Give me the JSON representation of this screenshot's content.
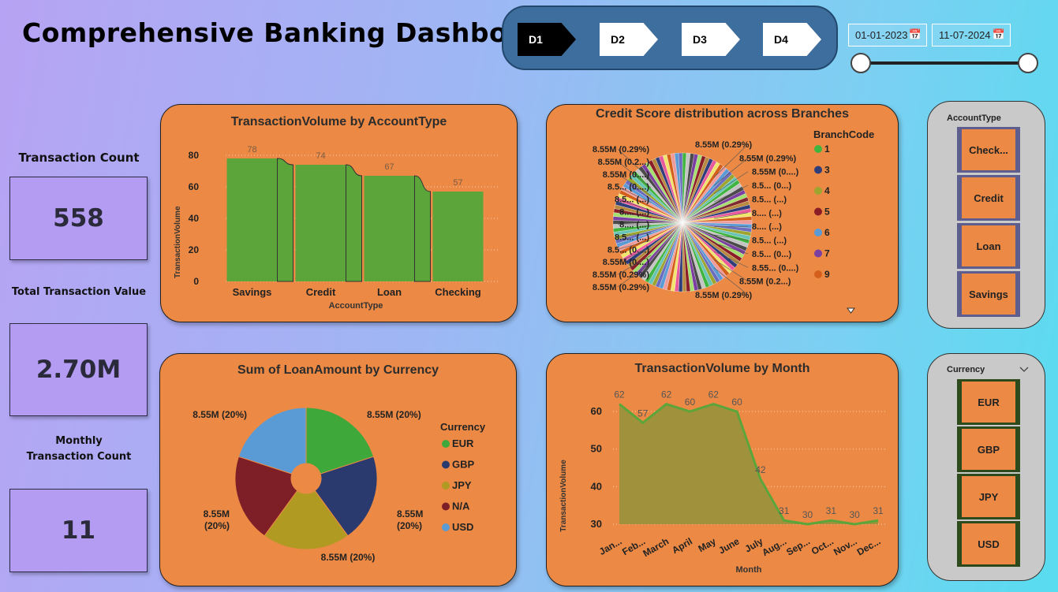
{
  "title": "Comprehensive Banking Dashboard",
  "nav": {
    "buttons": [
      "D1",
      "D2",
      "D3",
      "D4"
    ],
    "active": "D1"
  },
  "date_range": {
    "start": "01-01-2023",
    "end": "11-07-2024"
  },
  "kpis": [
    {
      "label": "Transaction Count",
      "value": "558"
    },
    {
      "label": "Total Transaction Value",
      "value": "2.70M"
    },
    {
      "label": "Monthly Transaction Count",
      "value": "11"
    }
  ],
  "charts": {
    "tv_by_account": {
      "title": "TransactionVolume by AccountType",
      "xlabel": "AccountType",
      "ylabel": "TransactionVolume"
    },
    "credit_score": {
      "title": "Credit Score distribution across Branches",
      "legend_title": "BranchCode"
    },
    "loan_by_currency": {
      "title": "Sum of LoanAmount by Currency",
      "legend_title": "Currency"
    },
    "tv_by_month": {
      "title": "TransactionVolume by Month",
      "xlabel": "Month",
      "ylabel": "TransactionVolume"
    }
  },
  "chart_data": [
    {
      "type": "bar",
      "title": "TransactionVolume by AccountType",
      "xlabel": "AccountType",
      "ylabel": "TransactionVolume",
      "categories": [
        "Savings",
        "Credit",
        "Loan",
        "Checking"
      ],
      "values": [
        78,
        74,
        67,
        57
      ],
      "yticks": [
        0,
        20,
        40,
        60,
        80
      ],
      "ylim": [
        0,
        80
      ],
      "color": "#5ba53a"
    },
    {
      "type": "pie",
      "title": "Credit Score distribution across Branches",
      "legend_title": "BranchCode",
      "legend": [
        {
          "label": "1",
          "color": "#3fb43f"
        },
        {
          "label": "3",
          "color": "#2f3e7a"
        },
        {
          "label": "4",
          "color": "#9da530"
        },
        {
          "label": "5",
          "color": "#8a1d25"
        },
        {
          "label": "6",
          "color": "#5b9bd5"
        },
        {
          "label": "7",
          "color": "#7a3fa0"
        },
        {
          "label": "9",
          "color": "#d35f1a"
        }
      ],
      "labels_left": [
        "8.55M (0.29%)",
        "8.55M (0.2...)",
        "8.55M (0....)",
        "8.5... (0....)",
        "8.5... (...)",
        "8.... (...)",
        "8.... (...)",
        "8.5... (...)",
        "8.5... (0....)",
        "8.55M (0....)",
        "8.55M (0.29%)",
        "8.55M (0.29%)"
      ],
      "labels_right": [
        "8.55M (0.29%)",
        "8.55M (0.29%)",
        "8.55M (0....)",
        "8.5... (0...)",
        "8.5... (...)",
        "8.... (...)",
        "8.... (...)",
        "8.5... (...)",
        "8.5... (0...)",
        "8.55... (0....)",
        "8.55M (0.2...)",
        "8.55M (0.29%)"
      ]
    },
    {
      "type": "pie",
      "title": "Sum of LoanAmount by Currency",
      "legend_title": "Currency",
      "categories": [
        "EUR",
        "GBP",
        "JPY",
        "N/A",
        "USD"
      ],
      "values": [
        8.55,
        8.55,
        8.55,
        8.55,
        8.55
      ],
      "labels": [
        "8.55M (20%)",
        "8.55M (20%)",
        "8.55M (20%)",
        "8.55M (20%)",
        "8.55M (20%)"
      ],
      "colors": [
        "#3fa83a",
        "#2b3a6e",
        "#b09a22",
        "#7e1f27",
        "#5b9bd5"
      ]
    },
    {
      "type": "area",
      "title": "TransactionVolume by Month",
      "xlabel": "Month",
      "ylabel": "TransactionVolume",
      "categories": [
        "Jan...",
        "Feb...",
        "March",
        "April",
        "May",
        "June",
        "July",
        "Aug...",
        "Sep...",
        "Oct...",
        "Nov...",
        "Dec..."
      ],
      "values": [
        62,
        57,
        62,
        60,
        62,
        60,
        42,
        31,
        30,
        31,
        30,
        31
      ],
      "yticks": [
        30,
        40,
        50,
        60
      ],
      "ylim": [
        30,
        64
      ],
      "color": "#5ba53a"
    }
  ],
  "slicers": {
    "account": {
      "title": "AccountType",
      "items": [
        "Check...",
        "Credit",
        "Loan",
        "Savings"
      ]
    },
    "currency": {
      "title": "Currency",
      "items": [
        "EUR",
        "GBP",
        "JPY",
        "USD"
      ]
    }
  }
}
